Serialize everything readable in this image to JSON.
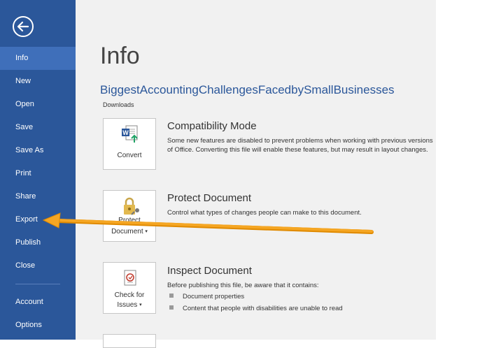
{
  "sidebar": {
    "back_icon": "back-arrow-circle-icon",
    "items": [
      {
        "label": "Info",
        "active": true
      },
      {
        "label": "New"
      },
      {
        "label": "Open"
      },
      {
        "label": "Save"
      },
      {
        "label": "Save As"
      },
      {
        "label": "Print"
      },
      {
        "label": "Share"
      },
      {
        "label": "Export"
      },
      {
        "label": "Publish"
      },
      {
        "label": "Close"
      },
      {
        "label": "Account"
      },
      {
        "label": "Options"
      }
    ]
  },
  "main": {
    "title": "Info",
    "document_name": "BiggestAccountingChallengesFacedbySmallBusinesses",
    "document_path": "Downloads",
    "sections": [
      {
        "button_label": "Convert",
        "title": "Compatibility Mode",
        "description": "Some new features are disabled to prevent problems when working with previous versions of Office. Converting this file will enable these features, but may result in layout changes."
      },
      {
        "button_label_line1": "Protect",
        "button_label_line2": "Document",
        "title": "Protect Document",
        "description": "Control what types of changes people can make to this document."
      },
      {
        "button_label_line1": "Check for",
        "button_label_line2": "Issues",
        "title": "Inspect Document",
        "description": "Before publishing this file, be aware that it contains:",
        "bullets": [
          "Document properties",
          "Content that people with disabilities are unable to read"
        ]
      }
    ]
  },
  "colors": {
    "sidebar": "#2b579a",
    "sidebar_active": "#3f6fba",
    "annotation_arrow": "#f5a623"
  }
}
